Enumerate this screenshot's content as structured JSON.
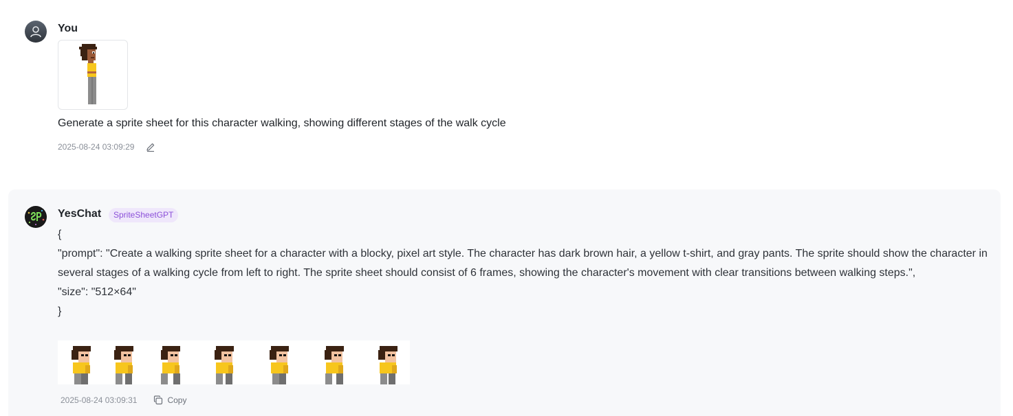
{
  "user_message": {
    "sender": "You",
    "text": "Generate a sprite sheet for this character walking, showing different stages of the walk cycle",
    "timestamp": "2025-08-24 03:09:29",
    "edit_icon": "pencil-icon",
    "attachment_icon": "character-sprite-image"
  },
  "assistant_message": {
    "sender": "YesChat",
    "badge": "SpriteSheetGPT",
    "lines": [
      "{",
      "\"prompt\": \"Create a walking sprite sheet for a character with a blocky, pixel art style. The character has dark brown hair, a yellow t-shirt, and gray pants. The sprite should show the character in several stages of a walking cycle from left to right. The sprite sheet should consist of 6 frames, showing the character's movement with clear transitions between walking steps.\",",
      "\"size\": \"512×64\"",
      "}"
    ],
    "timestamp": "2025-08-24 03:09:31",
    "copy_label": "Copy",
    "copy_icon": "copy-icon",
    "result_image": "walking-sprite-sheet-image"
  },
  "colors": {
    "badge_bg": "#efe7fb",
    "badge_text": "#8b4fd9",
    "card_bg": "#f7f8fa",
    "hair": "#3b2212",
    "skin": "#f2c2a0",
    "shirt": "#f7c61d",
    "pants": "#8c8c8c"
  }
}
